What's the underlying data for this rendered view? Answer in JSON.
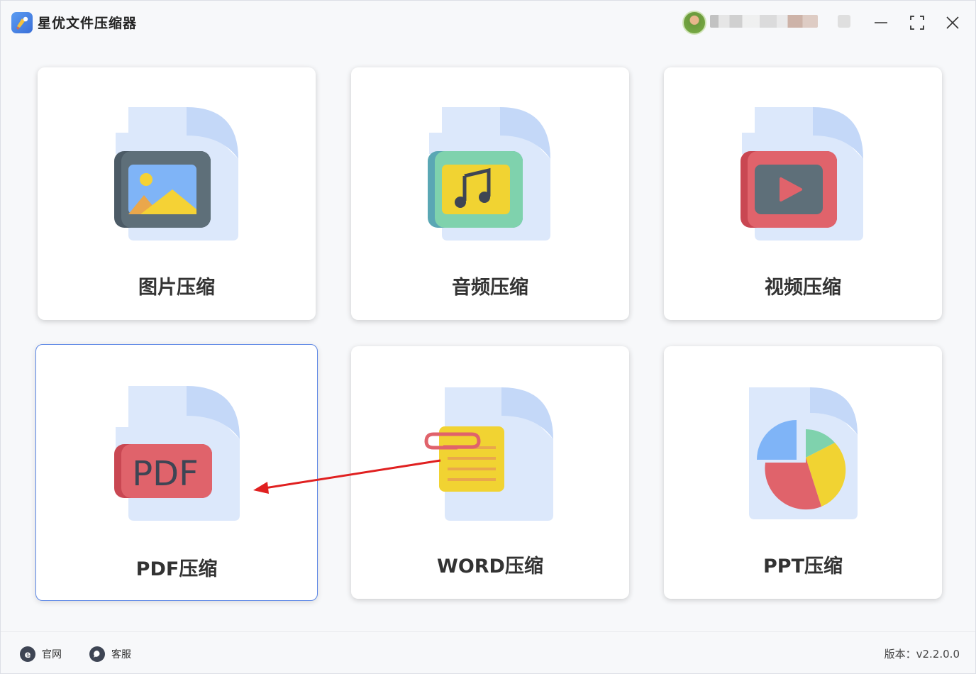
{
  "app": {
    "title": "星优文件压缩器"
  },
  "user": {
    "name": ""
  },
  "window_controls": {
    "minimize": "minimize-icon",
    "maximize": "maximize-icon",
    "close": "close-icon"
  },
  "tools": [
    {
      "label": "图片压缩",
      "icon": "image-file-icon"
    },
    {
      "label": "音频压缩",
      "icon": "audio-file-icon"
    },
    {
      "label": "视频压缩",
      "icon": "video-file-icon"
    },
    {
      "label": "PDF压缩",
      "icon": "pdf-file-icon",
      "selected": true
    },
    {
      "label": "WORD压缩",
      "icon": "word-file-icon"
    },
    {
      "label": "PPT压缩",
      "icon": "ppt-file-icon"
    }
  ],
  "footer": {
    "website_label": "官网",
    "support_label": "客服",
    "version_label": "版本：v2.2.0.0"
  },
  "colors": {
    "accent": "#5b86e5",
    "annotation_arrow": "#e02020",
    "doc_bg": "#dce8fb"
  }
}
